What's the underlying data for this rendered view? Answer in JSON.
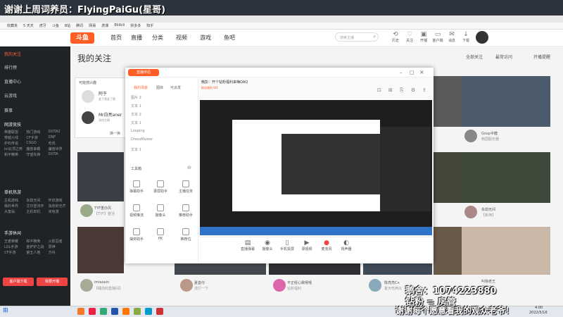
{
  "banner": {
    "text": "谢谢上周词养员：FlyingPaiGu(星哥)"
  },
  "bookmarks": [
    "收藏夹",
    "5 天天",
    "虎牙",
    "斗鱼",
    "B站",
    "腾讯",
    "网易",
    "虎课",
    "Bilibili",
    "拼多多",
    "知乎"
  ],
  "site": {
    "logo": "斗鱼",
    "nav": [
      "首页",
      "直播",
      "分类",
      "视频",
      "游戏",
      "鱼吧"
    ],
    "search_placeholder": "搜索主播",
    "tools": [
      {
        "label": "历史",
        "icon": "history-icon",
        "glyph": "⟲"
      },
      {
        "label": "关注",
        "icon": "heart-icon",
        "glyph": "♡"
      },
      {
        "label": "开播",
        "icon": "camera-icon",
        "glyph": "▣"
      },
      {
        "label": "客户端",
        "icon": "monitor-icon",
        "glyph": "▭"
      },
      {
        "label": "消息",
        "icon": "bell-icon",
        "glyph": "✉"
      },
      {
        "label": "下载",
        "icon": "download-icon",
        "glyph": "↓"
      }
    ]
  },
  "sidebar": {
    "items": [
      {
        "label": "我的关注",
        "active": true
      },
      {
        "label": "排行榜",
        "active": false
      },
      {
        "label": "直播中心",
        "active": false
      },
      {
        "label": "云游戏",
        "active": false
      },
      {
        "label": "赛事",
        "active": false
      }
    ],
    "section_hot": "网游竞技",
    "hot_grid": [
      "英雄联盟",
      "热门游戏",
      "DOTA2",
      "穿越火线",
      "CF手游",
      "DNF",
      "炉石传说",
      "CSGO",
      "吃鸡",
      "lol云顶之弈",
      "魔兽争霸",
      "魔兽世界",
      "和平精英",
      "守望先锋",
      "DOTA"
    ],
    "section_mobile": "单机热游",
    "mobile_grid": [
      "主机游戏",
      "永劫无间",
      "怀旧游戏",
      "我的世界",
      "艾尔登法环",
      "消逝的光芒",
      "大富翁",
      "主机单机",
      "米哈游"
    ],
    "section_fun": "手游休闲",
    "fun_grid": [
      "王者荣耀",
      "和平精英",
      "火影忍者",
      "LOL手游",
      "金铲铲之战",
      "原神",
      "CF手游",
      "第五人格",
      "方舟"
    ],
    "btn_app": "客户端下载",
    "btn_live": "我要开播"
  },
  "page": {
    "title": "我的关注",
    "filter_all": "全部关注",
    "filter_recent": "最常访问",
    "filter_remind": "开播提醒"
  },
  "panel": {
    "title": "可能感兴趣",
    "rows": [
      {
        "name": "阿于",
        "sub": "爱了哦爱了哦"
      },
      {
        "name": "Mr白亮aner",
        "sub": "游戏主播"
      }
    ],
    "more": "换一换"
  },
  "window": {
    "title": "直播伴侣",
    "tabs": [
      "我的场景",
      "图库",
      "可派发"
    ],
    "scenes": [
      "图片 2",
      "文本 1",
      "文本 2",
      "文本 1",
      "Looping",
      "DressMaster",
      "文本 1"
    ],
    "tools_header": "工具箱",
    "tools": [
      "弹幕助手",
      "录屏助手",
      "主播任务",
      "视频推流",
      "摄像头",
      "推荐助手",
      "抽奖助手",
      "PK",
      "推荐位"
    ],
    "stream_title": "韩彭：开个钻粉福利来嗨QAQ",
    "bottom": [
      "直播弹幕",
      "摄像头",
      "手机投屏",
      "录视频",
      "麦克风",
      "扬声器"
    ],
    "lucky": "粉丝福利 8/4"
  },
  "cards": [
    {
      "name": "TYF重办风",
      "sub": "【TYF】整活"
    },
    {
      "name": "imiaoxin",
      "sub": "【睡前的直播间】"
    },
    {
      "name": "夏善仔",
      "sub": "流行一下"
    },
    {
      "name": "不正经心跳嘻嘻",
      "sub": "钻粉福利"
    },
    {
      "name": "陈亮亮Cn",
      "sub": "夏天吃西瓜"
    },
    {
      "name": "Gnsp半糖",
      "sub": "韩国服务器"
    },
    {
      "name": "永劫无间",
      "sub": "【新神】"
    },
    {
      "name": "叫我老王",
      "sub": "直播中"
    }
  ],
  "overlay": {
    "line1": "鹅舍：1074223880",
    "line2": "钻粉 = 房管",
    "line3": "谢谢每个愿意看我的观众老爷！"
  },
  "taskbar": {
    "time": "4:00",
    "date": "2022/5/16",
    "start": "Windows"
  },
  "colors": {
    "accent": "#ff5d23",
    "sidebar_bg": "#1f2227",
    "active": "#ff6a3d"
  }
}
